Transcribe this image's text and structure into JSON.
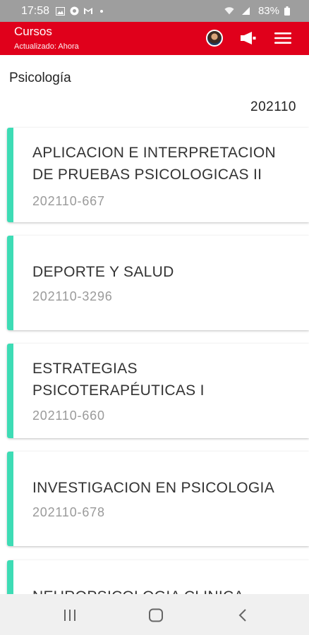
{
  "status_bar": {
    "time": "17:58",
    "battery": "83%"
  },
  "app_bar": {
    "title": "Cursos",
    "subtitle": "Actualizado: Ahora"
  },
  "section": {
    "title": "Psicología",
    "period": "202110"
  },
  "courses": [
    {
      "name": "APLICACION E INTERPRETACION DE PRUEBAS PSICOLOGICAS II",
      "code": "202110-667"
    },
    {
      "name": "DEPORTE Y SALUD",
      "code": "202110-3296"
    },
    {
      "name": "ESTRATEGIAS PSICOTERAPÉUTICAS I",
      "code": "202110-660"
    },
    {
      "name": "INVESTIGACION EN PSICOLOGIA",
      "code": "202110-678"
    },
    {
      "name": "NEUROPSICOLOGIA CLINICA",
      "code": ""
    }
  ],
  "colors": {
    "app_bar": "#e0001b",
    "accent": "#3ddcb5"
  }
}
